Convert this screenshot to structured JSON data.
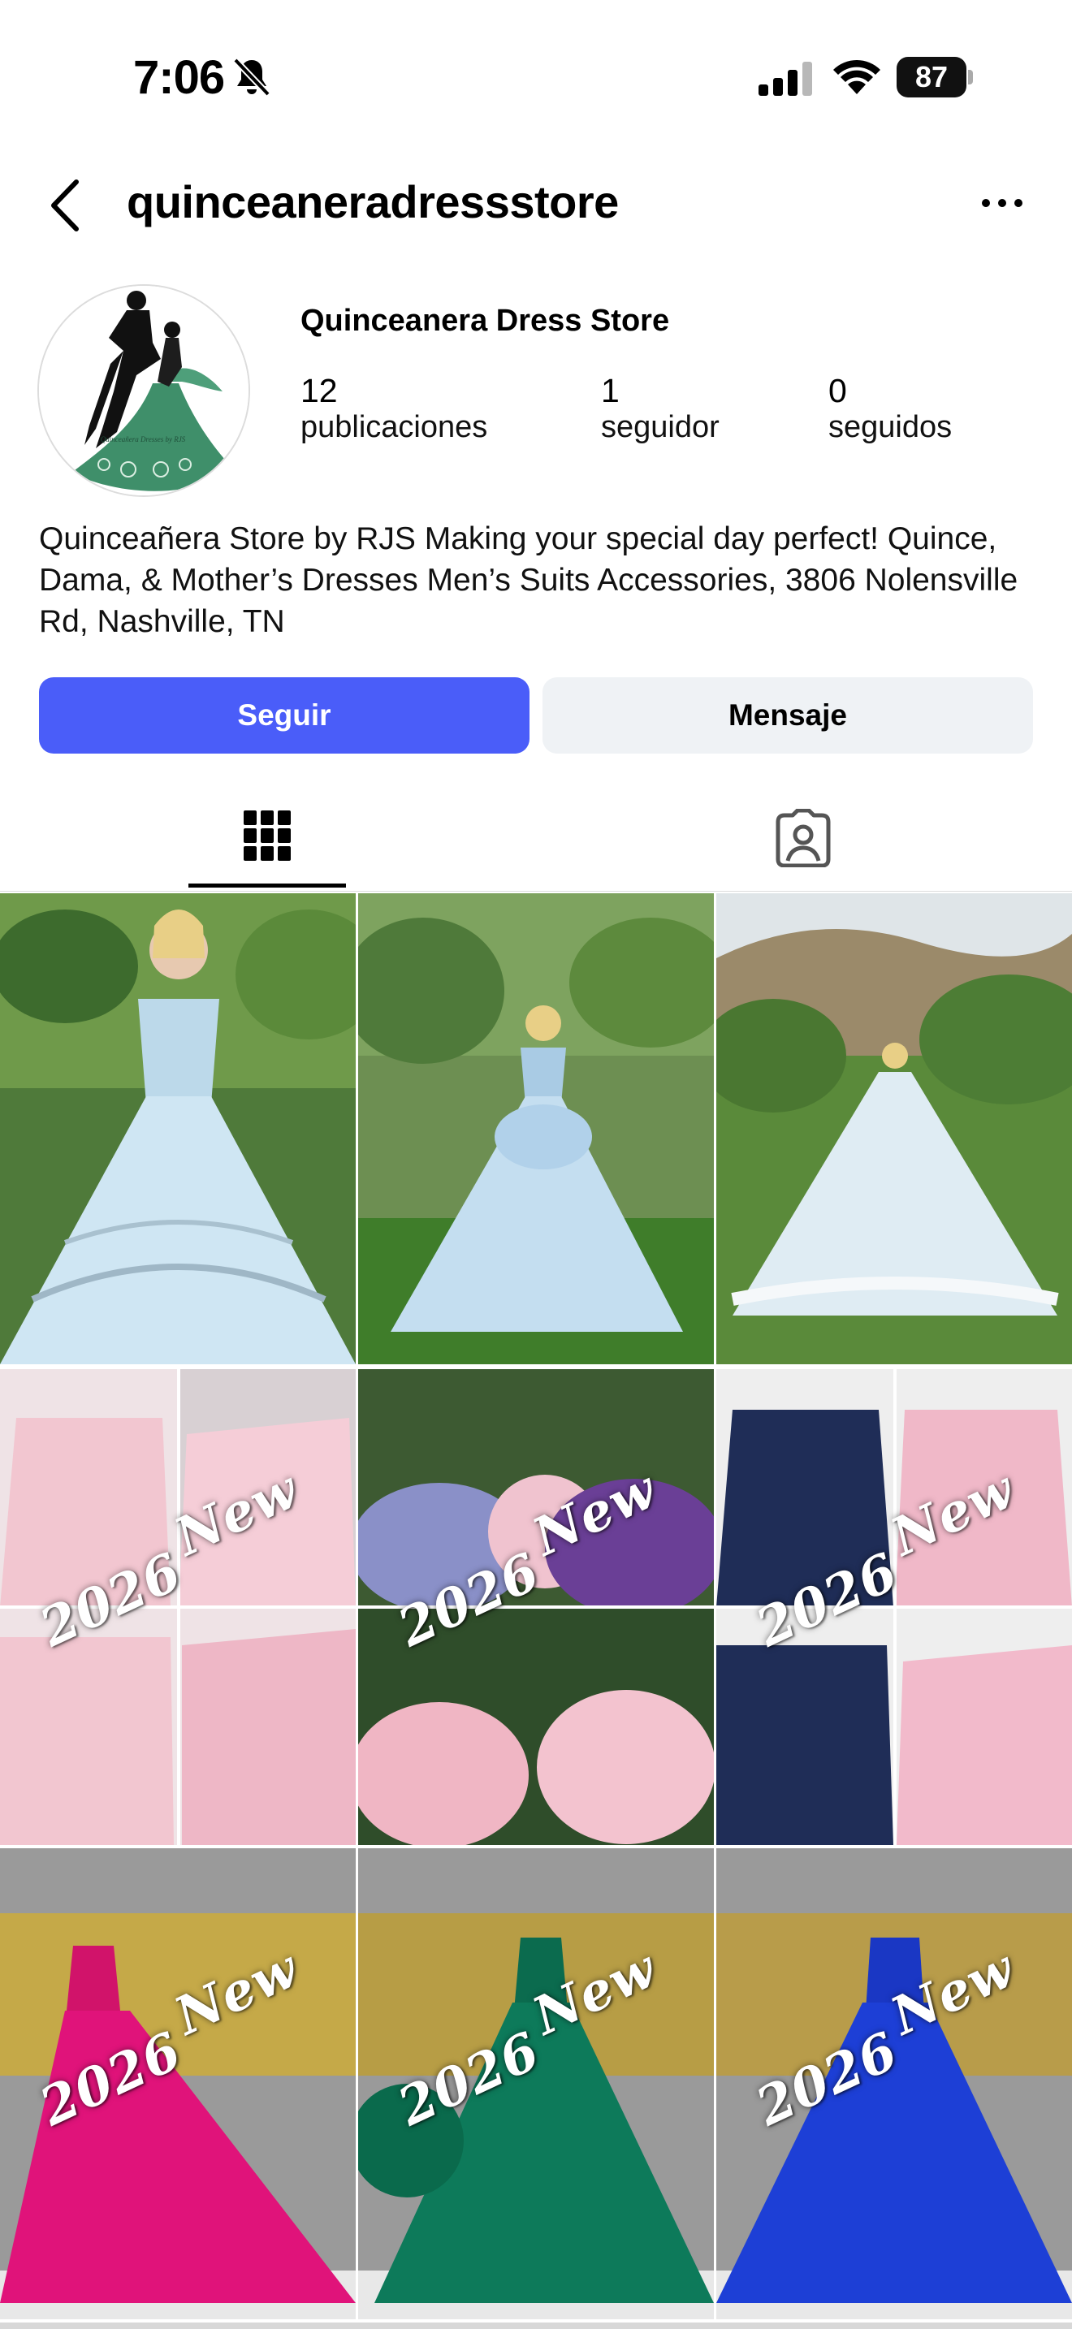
{
  "status_bar": {
    "time": "7:06",
    "battery": "87",
    "icons": [
      "bell-slash-icon",
      "cellular-signal-icon",
      "wifi-icon",
      "battery-icon"
    ]
  },
  "header": {
    "username": "quinceaneradressstore",
    "back_icon": "chevron-left-icon",
    "more_icon": "more-horizontal-icon"
  },
  "profile": {
    "avatar_caption": "Quinceañera Dresses by RJS",
    "full_name": "Quinceanera Dress Store",
    "stats": [
      {
        "value": "12",
        "label": "publicaciones"
      },
      {
        "value": "1",
        "label": "seguidor"
      },
      {
        "value": "0",
        "label": "seguidos"
      }
    ],
    "bio": "Quinceañera Store by RJS Making your special day perfect! Quince, Dama, & Mother’s Dresses Men’s Suits Accessories, 3806 Nolensville Rd, Nashville, TN"
  },
  "actions": {
    "follow_label": "Seguir",
    "message_label": "Mensaje"
  },
  "tabs": [
    {
      "icon": "grid-icon",
      "active": true
    },
    {
      "icon": "tagged-person-icon",
      "active": false
    }
  ],
  "colors": {
    "follow_button": "#4a5df9",
    "message_button": "#eff2f5"
  },
  "posts": [
    {
      "overlay_year": "",
      "overlay_new": "",
      "dress_color": "#cfe6f3"
    },
    {
      "overlay_year": "",
      "overlay_new": "",
      "dress_color": "#c4def0"
    },
    {
      "overlay_year": "",
      "overlay_new": "",
      "dress_color": "#dfecf3"
    },
    {
      "overlay_year": "2026",
      "overlay_new": "New",
      "dress_color": "#f2c6d0"
    },
    {
      "overlay_year": "2026",
      "overlay_new": "New",
      "dress_color": "#8a90c8"
    },
    {
      "overlay_year": "2026",
      "overlay_new": "New",
      "dress_color": "#1f2d57"
    },
    {
      "overlay_year": "2026",
      "overlay_new": "New",
      "dress_color": "#e0137a"
    },
    {
      "overlay_year": "2026",
      "overlay_new": "New",
      "dress_color": "#0d7a5a"
    },
    {
      "overlay_year": "2026",
      "overlay_new": "New",
      "dress_color": "#1d3fd6"
    }
  ]
}
